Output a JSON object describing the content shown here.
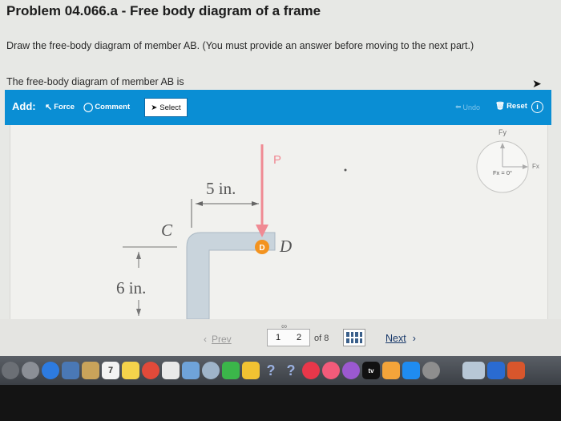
{
  "page": {
    "title": "Problem 04.066.a - Free body diagram of a frame",
    "instruction": "Draw the free-body diagram of member AB. (You must provide an answer before moving to the next part.)",
    "fbd_label": "The free-body diagram of member AB is"
  },
  "toolbar": {
    "add_label": "Add:",
    "force_label": "Force",
    "comment_label": "Comment",
    "select_label": "Select",
    "undo_label": "Undo",
    "reset_label": "Reset",
    "info_label": "i"
  },
  "diagram": {
    "label_5in": "5 in.",
    "label_6in": "6 in.",
    "label_c": "C",
    "label_d": "D",
    "marker_d": "D",
    "force_p": "P",
    "compass_fy": "Fy",
    "compass_fx": "Fx",
    "compass_readout": "Fx = 0°",
    "accent_color": "#f08a93",
    "member_color": "#c9d4dc",
    "marker_color": "#f3931f"
  },
  "nav": {
    "prev_label": "Prev",
    "page_1": "1",
    "page_2": "2",
    "of_label": "of 8",
    "next_label": "Next"
  },
  "dock": {
    "calendar_day": "7",
    "help_glyph": "?",
    "tv_label": "tv"
  }
}
